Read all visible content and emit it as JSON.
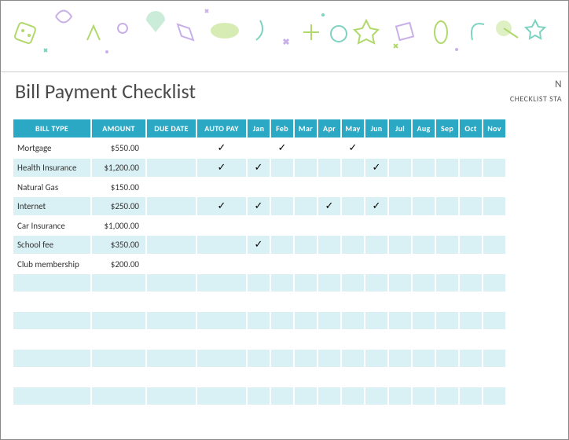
{
  "title": "Bill Payment Checklist",
  "topRight": {
    "line1": "N",
    "line2": "CHECKLIST STA"
  },
  "headers": {
    "billType": "BILL TYPE",
    "amount": "AMOUNT",
    "dueDate": "DUE DATE",
    "autoPay": "AUTO PAY",
    "months": [
      "Jan",
      "Feb",
      "Mar",
      "Apr",
      "May",
      "Jun",
      "Jul",
      "Aug",
      "Sep",
      "Oct",
      "Nov"
    ]
  },
  "checkmark": "✓",
  "rows": [
    {
      "bill": "Mortgage",
      "amount": "$550.00",
      "dueDate": "",
      "autoPay": true,
      "months": [
        false,
        true,
        false,
        false,
        true,
        false,
        false,
        false,
        false,
        false,
        false
      ]
    },
    {
      "bill": "Health Insurance",
      "amount": "$1,200.00",
      "dueDate": "",
      "autoPay": true,
      "months": [
        true,
        false,
        false,
        false,
        false,
        true,
        false,
        false,
        false,
        false,
        false
      ]
    },
    {
      "bill": "Natural Gas",
      "amount": "$150.00",
      "dueDate": "",
      "autoPay": false,
      "months": [
        false,
        false,
        false,
        false,
        false,
        false,
        false,
        false,
        false,
        false,
        false
      ]
    },
    {
      "bill": "Internet",
      "amount": "$250.00",
      "dueDate": "",
      "autoPay": true,
      "months": [
        true,
        false,
        false,
        true,
        false,
        true,
        false,
        false,
        false,
        false,
        false
      ]
    },
    {
      "bill": "Car Insurance",
      "amount": "$1,000.00",
      "dueDate": "",
      "autoPay": false,
      "months": [
        false,
        false,
        false,
        false,
        false,
        false,
        false,
        false,
        false,
        false,
        false
      ]
    },
    {
      "bill": "School fee",
      "amount": "$350.00",
      "dueDate": "",
      "autoPay": false,
      "months": [
        true,
        false,
        false,
        false,
        false,
        false,
        false,
        false,
        false,
        false,
        false
      ]
    },
    {
      "bill": "Club membership",
      "amount": "$200.00",
      "dueDate": "",
      "autoPay": false,
      "months": [
        false,
        false,
        false,
        false,
        false,
        false,
        false,
        false,
        false,
        false,
        false
      ]
    },
    {
      "bill": "",
      "amount": "",
      "dueDate": "",
      "autoPay": false,
      "months": [
        false,
        false,
        false,
        false,
        false,
        false,
        false,
        false,
        false,
        false,
        false
      ]
    },
    {
      "bill": "",
      "amount": "",
      "dueDate": "",
      "autoPay": false,
      "months": [
        false,
        false,
        false,
        false,
        false,
        false,
        false,
        false,
        false,
        false,
        false
      ]
    },
    {
      "bill": "",
      "amount": "",
      "dueDate": "",
      "autoPay": false,
      "months": [
        false,
        false,
        false,
        false,
        false,
        false,
        false,
        false,
        false,
        false,
        false
      ]
    },
    {
      "bill": "",
      "amount": "",
      "dueDate": "",
      "autoPay": false,
      "months": [
        false,
        false,
        false,
        false,
        false,
        false,
        false,
        false,
        false,
        false,
        false
      ]
    },
    {
      "bill": "",
      "amount": "",
      "dueDate": "",
      "autoPay": false,
      "months": [
        false,
        false,
        false,
        false,
        false,
        false,
        false,
        false,
        false,
        false,
        false
      ]
    },
    {
      "bill": "",
      "amount": "",
      "dueDate": "",
      "autoPay": false,
      "months": [
        false,
        false,
        false,
        false,
        false,
        false,
        false,
        false,
        false,
        false,
        false
      ]
    },
    {
      "bill": "",
      "amount": "",
      "dueDate": "",
      "autoPay": false,
      "months": [
        false,
        false,
        false,
        false,
        false,
        false,
        false,
        false,
        false,
        false,
        false
      ]
    }
  ]
}
